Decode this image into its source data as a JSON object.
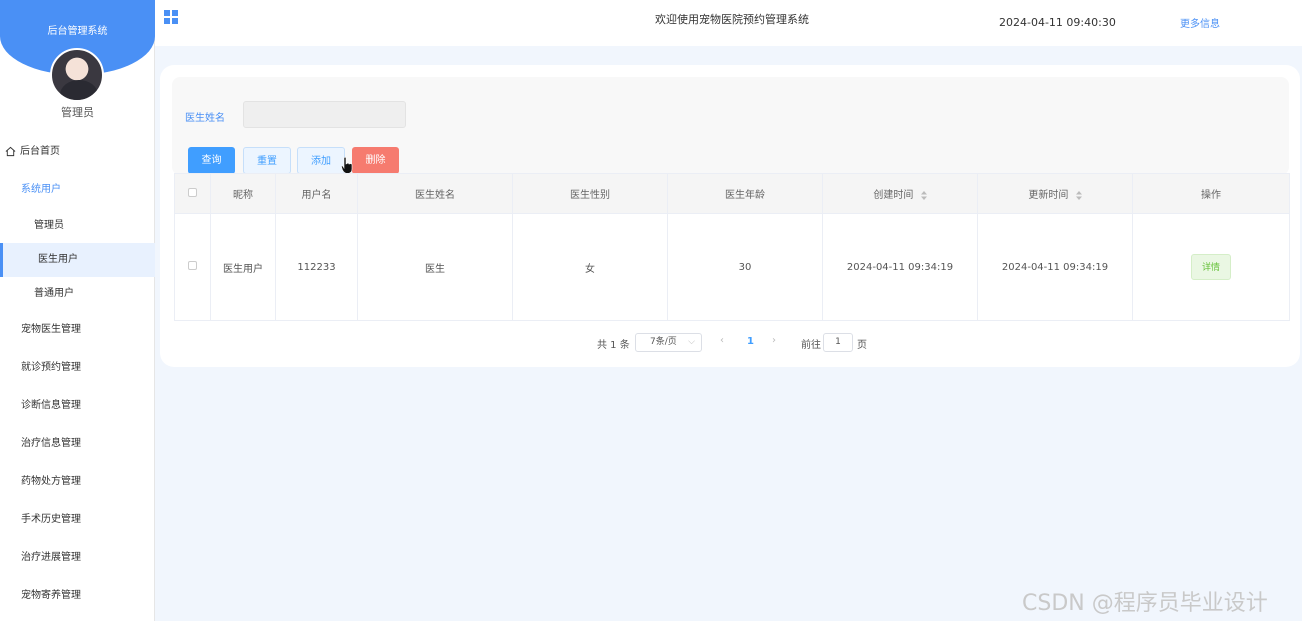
{
  "sidebar": {
    "brand": "后台管理系统",
    "user_role": "管理员",
    "home": "后台首页",
    "group_label": "系统用户",
    "sub_items": [
      "管理员",
      "医生用户",
      "普通用户"
    ],
    "menu_items": [
      "宠物医生管理",
      "就诊预约管理",
      "诊断信息管理",
      "治疗信息管理",
      "药物处方管理",
      "手术历史管理",
      "治疗进展管理",
      "宠物寄养管理"
    ]
  },
  "header": {
    "title": "欢迎使用宠物医院预约管理系统",
    "time": "2024-04-11 09:40:30",
    "more": "更多信息"
  },
  "filter": {
    "label": "医生姓名",
    "input_value": "",
    "buttons": {
      "query": "查询",
      "reset": "重置",
      "add": "添加",
      "delete": "删除"
    }
  },
  "table": {
    "headers": [
      "昵称",
      "用户名",
      "医生姓名",
      "医生性别",
      "医生年龄",
      "创建时间",
      "更新时间",
      "操作"
    ],
    "rows": [
      {
        "nickname": "医生用户",
        "username": "112233",
        "name": "医生",
        "gender": "女",
        "age": "30",
        "created": "2024-04-11 09:34:19",
        "updated": "2024-04-11 09:34:19",
        "action": "详情"
      }
    ]
  },
  "pager": {
    "total": "共 1 条",
    "page_size": "7条/页",
    "current": "1",
    "goto_label": "前往",
    "goto_value": "1",
    "page_suffix": "页"
  },
  "watermark": "CSDN @程序员毕业设计"
}
